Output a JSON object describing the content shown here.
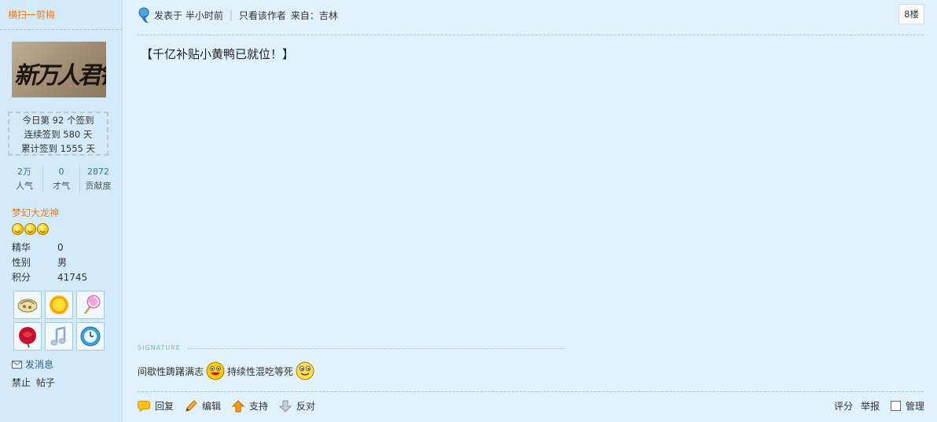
{
  "sidebar": {
    "username": "横扫一剪梅",
    "avatar_alt_text": "新万人君锁",
    "checkin": {
      "line1": "今日第 92 个签到",
      "line2": "连续签到 580 天",
      "line3": "累计签到 1555 天"
    },
    "stats": [
      {
        "value": "2万",
        "label": "人气"
      },
      {
        "value": "0",
        "label": "才气"
      },
      {
        "value": "2872",
        "label": "贡献度"
      }
    ],
    "group": "梦幻大龙神",
    "level_icons": [
      "smile-icon",
      "smile-icon",
      "smile-icon"
    ],
    "info": [
      {
        "key": "精华",
        "value": "0"
      },
      {
        "key": "性别",
        "value": "男"
      },
      {
        "key": "积分",
        "value": "41745"
      }
    ],
    "medals": [
      "fossil-icon",
      "sun-icon",
      "lollipop-icon",
      "rose-icon",
      "music-note-icon",
      "clock-icon"
    ],
    "send_message": "发消息",
    "ban_label": "禁止",
    "posts_label": "帖子"
  },
  "post": {
    "posted": "发表于 半小时前",
    "only_author": "只看该作者",
    "from": "来自：吉林",
    "floor": "8楼",
    "content": "【千亿补贴小黄鸭已就位！】",
    "signature_label": "SIGNATURE",
    "signature_text1": "间歇性踌躇满志",
    "signature_text2": "持续性混吃等死"
  },
  "actions": {
    "reply": "回复",
    "edit": "编辑",
    "support": "支持",
    "oppose": "反对",
    "rate": "评分",
    "report": "举报",
    "manage": "管理"
  },
  "colors": {
    "background": "#e2f2fc",
    "sidebar": "#d3ebf9",
    "accent_orange": "#f07a1c",
    "link_blue": "#34719a"
  }
}
